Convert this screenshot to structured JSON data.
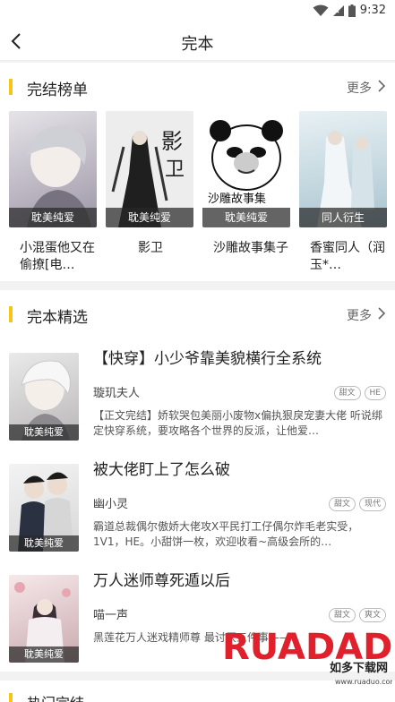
{
  "status": {
    "time": "9:32"
  },
  "header": {
    "title": "完本"
  },
  "ranking": {
    "title": "完结榜单",
    "more": "更多",
    "items": [
      {
        "name": "小混蛋他又在偷撩[电…",
        "tag": "耽美纯爱",
        "colors": [
          "#d9d6dc",
          "#8a8595"
        ]
      },
      {
        "name": "影卫",
        "tag": "耽美纯爱",
        "colors": [
          "#efefef",
          "#2b2b2b"
        ]
      },
      {
        "name": "沙雕故事集子",
        "tag": "耽美纯爱",
        "colors": [
          "#ffffff",
          "#111111"
        ]
      },
      {
        "name": "香蜜同人（润玉*…",
        "tag": "同人衍生",
        "colors": [
          "#d4e6ee",
          "#6f8f9f"
        ]
      }
    ]
  },
  "selected": {
    "title": "完本精选",
    "more": "更多",
    "books": [
      {
        "title": "【快穿】小少爷靠美貌横行全系统",
        "author": "璇玑夫人",
        "tags": [
          "甜文",
          "HE"
        ],
        "desc": "【正文完结】娇软哭包美丽小废物x偏执狠戾宠妻大佬 听说绑定快穿系统，要攻略各个世界的反派，让他爱…",
        "cover_tag": "耽美纯爱"
      },
      {
        "title": "被大佬盯上了怎么破",
        "author": "幽小灵",
        "tags": [
          "甜文",
          "现代"
        ],
        "desc": "霸道总裁偶尔傲娇大佬攻X平民打工仔偶尔炸毛老实受，1V1，HE。小甜饼一枚，欢迎收看~高级会所的…",
        "cover_tag": "耽美纯爱"
      },
      {
        "title": "万人迷师尊死遁以后",
        "author": "喵一声",
        "tags": [
          "甜文",
          "爽文"
        ],
        "desc": "黑莲花万人迷戏精师尊 最讨厌三件事——：",
        "cover_tag": "耽美纯爱"
      }
    ]
  },
  "hot": {
    "title": "热门完结"
  },
  "watermark": {
    "brand": "RUADADO",
    "sub": "如多下载网",
    "url": "www.ruaduo.com"
  }
}
